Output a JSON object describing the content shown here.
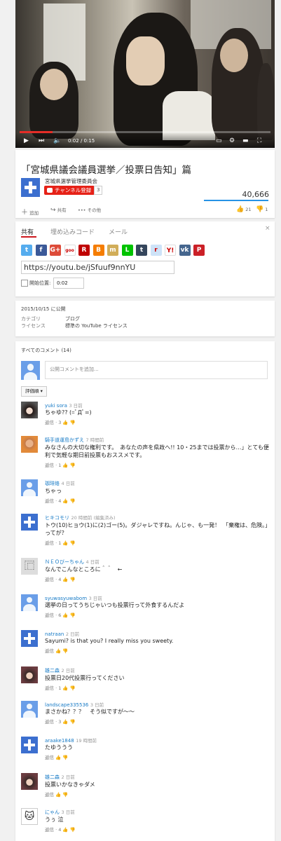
{
  "video": {
    "time": "0:02 / 0:15",
    "progress": 0.13
  },
  "title": "「宮城県議会議員選挙／投票日告知」篇",
  "channel": {
    "name": "宮城県選挙管理委員会",
    "subscribe_label": "チャンネル登録",
    "subscriber_count": "3"
  },
  "views": "40,666",
  "actions": {
    "add": "追加",
    "share": "共有",
    "more": "その他",
    "likes": "21",
    "dislikes": "1"
  },
  "share": {
    "tabs": [
      "共有",
      "埋め込みコード",
      "メール"
    ],
    "url": "https://youtu.be/jSfuuf9nnYU",
    "start_label": "開始位置:",
    "start_value": "0:02",
    "services": [
      {
        "icon": "twitter-icon",
        "glyph": "t",
        "color": "#55acee"
      },
      {
        "icon": "facebook-icon",
        "glyph": "f",
        "color": "#3b5998"
      },
      {
        "icon": "google-plus-icon",
        "glyph": "G+",
        "color": "#dd4b39"
      },
      {
        "icon": "goo-icon",
        "glyph": "goo",
        "color": "#ffffff"
      },
      {
        "icon": "rakuten-icon",
        "glyph": "R",
        "color": "#bf0000"
      },
      {
        "icon": "blogger-icon",
        "glyph": "B",
        "color": "#f57d00"
      },
      {
        "icon": "mixi-icon",
        "glyph": "m",
        "color": "#d1ad59"
      },
      {
        "icon": "line-icon",
        "glyph": "L",
        "color": "#00c300"
      },
      {
        "icon": "tumblr-icon",
        "glyph": "t",
        "color": "#35465c"
      },
      {
        "icon": "reddit-icon",
        "glyph": "r",
        "color": "#cee3f8"
      },
      {
        "icon": "yahoo-icon",
        "glyph": "Y!",
        "color": "#ffffff"
      },
      {
        "icon": "vk-icon",
        "glyph": "vk",
        "color": "#45668e"
      },
      {
        "icon": "pinterest-icon",
        "glyph": "P",
        "color": "#cb2027"
      }
    ]
  },
  "info": {
    "published": "2015/10/15 に公開",
    "category_label": "カテゴリ",
    "category": "ブログ",
    "license_label": "ライセンス",
    "license": "標準の YouTube ライセンス"
  },
  "comments_section": {
    "header": "すべてのコメント (14)",
    "input_placeholder": "公開コメントを追加...",
    "sort": "評価順",
    "reply_label": "返信",
    "items": [
      {
        "name": "yuki sora",
        "time": "3 日前",
        "text": "ちゃゆ?? (=ﾟДﾟ=)",
        "likes": "3",
        "avatar": "photo-girl"
      },
      {
        "name": "騎手道運島かずえ",
        "time": "7 時間前",
        "text": "みなさんの大切な権利です。　あなたの声を県政へ!! 10・25までは投票から…」とても便利で気軽な期日前投票もおススメです。",
        "likes": "1",
        "avatar": "photo-man"
      },
      {
        "name": "珈琲烙",
        "time": "4 日前",
        "text": "ちゃっ",
        "likes": "4",
        "avatar": "person"
      },
      {
        "name": "ヒキコモリ",
        "time": "20 時間前 (編集済み)",
        "text": "トウ(10)ヒョウ(1)に(2)ゴー(5)。ダジャレですね。んじゃ、も一発！　「棄権は、危険。」ってが？",
        "likes": "1",
        "avatar": "plus"
      },
      {
        "name": "ＮＥＯびーちゃん",
        "time": "4 日前",
        "text": "なんでこんなところに＾＾　←",
        "likes": "4",
        "avatar": "kanji"
      },
      {
        "name": "syuwasyuwabom",
        "time": "3 日前",
        "text": "選挙の日ってうちじゃいつも投票行って外食するんだよ",
        "likes": "6",
        "avatar": "person"
      },
      {
        "name": "natraan",
        "time": "2 日前",
        "text": "Sayumi? is that you? I really miss you sweety.",
        "likes": "",
        "avatar": "plus"
      },
      {
        "name": "雄二森",
        "time": "2 日前",
        "text": "投票日20代投票行ってください",
        "likes": "1",
        "avatar": "photo-girl2"
      },
      {
        "name": "landscape335536",
        "time": "3 日前",
        "text": "まさかね？？？　そう似ですが〜〜",
        "likes": "3",
        "avatar": "person"
      },
      {
        "name": "araake1848",
        "time": "19 時間前",
        "text": "たゆううう",
        "likes": "",
        "avatar": "plus"
      },
      {
        "name": "雄二森",
        "time": "2 日前",
        "text": "投票いかなきゃダメ",
        "likes": "",
        "avatar": "photo-girl2"
      },
      {
        "name": "にゃん",
        "time": "3 日前",
        "text": "うぅ 泣",
        "likes": "4",
        "avatar": "cat"
      }
    ]
  }
}
